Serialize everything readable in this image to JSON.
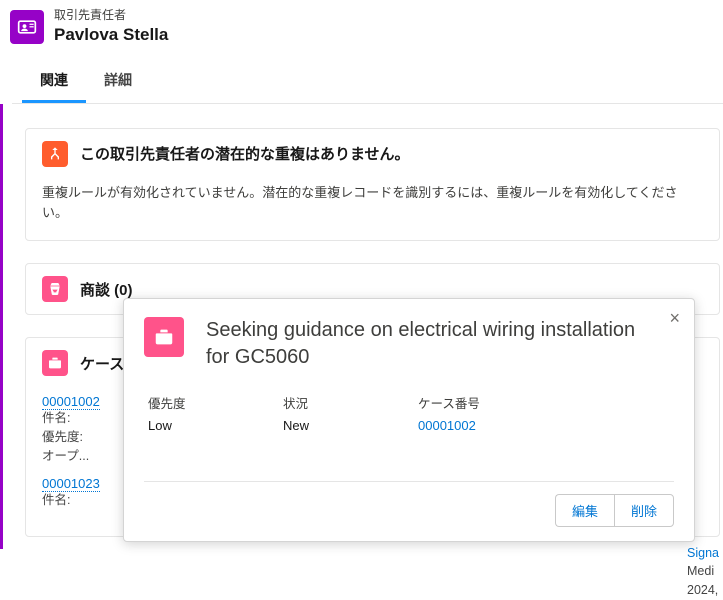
{
  "header": {
    "object_label": "取引先責任者",
    "record_name": "Pavlova Stella"
  },
  "tabs": {
    "related": "関連",
    "detail": "詳細"
  },
  "duplicate_card": {
    "title": "この取引先責任者の潜在的な重複はありません。",
    "description": "重複ルールが有効化されていません。潜在的な重複レコードを識別するには、重複ルールを有効化してください。"
  },
  "opportunity_card": {
    "title": "商談 (0)"
  },
  "case_card": {
    "title_prefix": "ケース",
    "items": [
      {
        "number": "00001002",
        "subject_label": "件名:",
        "priority_label": "優先度:",
        "open_label": "オープ..."
      },
      {
        "number": "00001023",
        "subject_label": "件名:"
      }
    ]
  },
  "right_partial": {
    "line1": "Signa",
    "line2": "Medi",
    "line3": "2024,"
  },
  "popover": {
    "title": "Seeking guidance on electrical wiring installation for GC5060",
    "fields": {
      "priority": {
        "label": "優先度",
        "value": "Low"
      },
      "status": {
        "label": "状況",
        "value": "New"
      },
      "case_no": {
        "label": "ケース番号",
        "value": "00001002"
      }
    },
    "buttons": {
      "edit": "編集",
      "delete": "削除"
    }
  }
}
